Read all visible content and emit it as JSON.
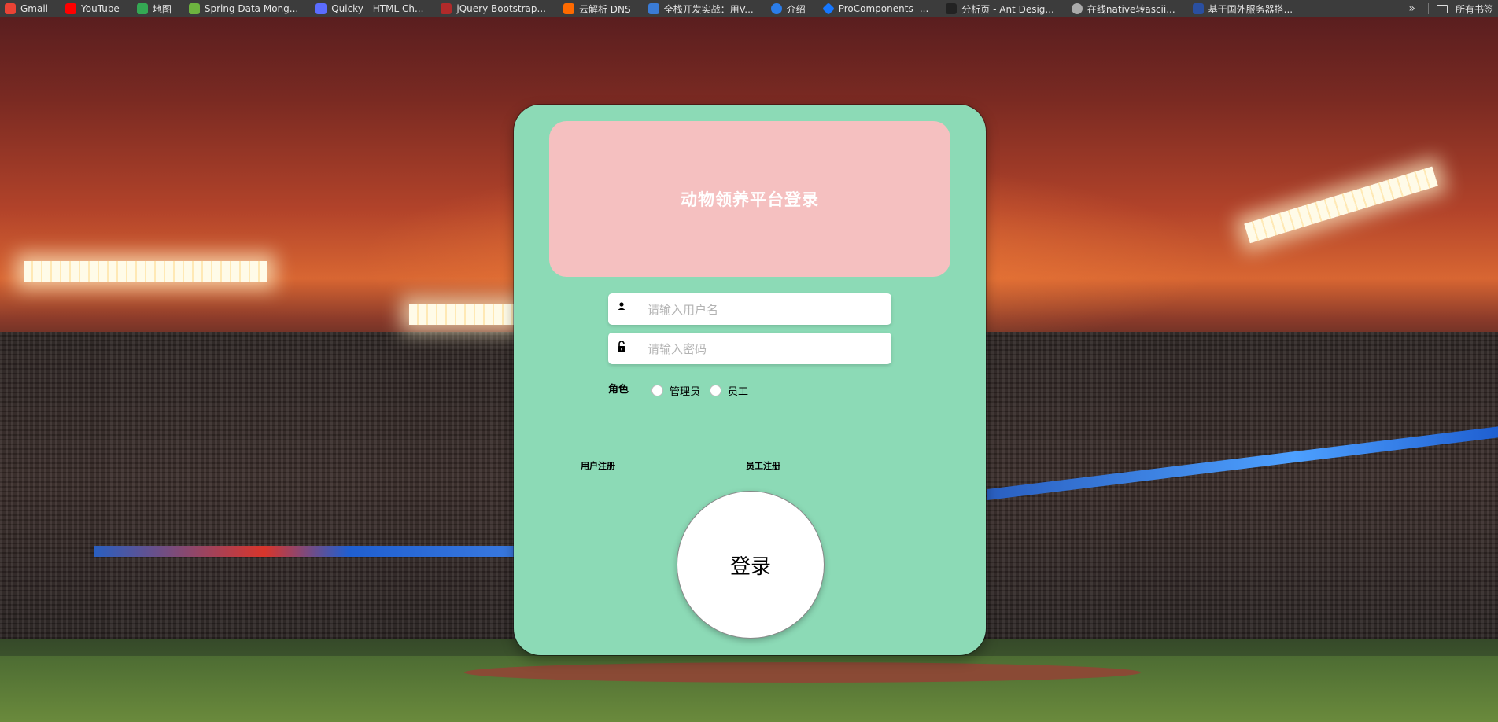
{
  "bookmarks": [
    {
      "label": "Gmail",
      "icon": "gmail-icon",
      "color": "#ea4335"
    },
    {
      "label": "YouTube",
      "icon": "youtube-icon",
      "color": "#ff0000"
    },
    {
      "label": "地图",
      "icon": "maps-icon",
      "color": "#34a853"
    },
    {
      "label": "Spring Data Mong...",
      "icon": "spring-icon",
      "color": "#6db33f"
    },
    {
      "label": "Quicky - HTML Ch...",
      "icon": "quicky-icon",
      "color": "#5b6cff"
    },
    {
      "label": "jQuery Bootstrap...",
      "icon": "jquery-icon",
      "color": "#b02a2a"
    },
    {
      "label": "云解析 DNS",
      "icon": "aliyun-icon",
      "color": "#ff6a00"
    },
    {
      "label": "全栈开发实战：用V...",
      "icon": "doc-icon",
      "color": "#3a7bd5"
    },
    {
      "label": "介绍",
      "icon": "intro-icon",
      "color": "#2b7de9"
    },
    {
      "label": "ProComponents -...",
      "icon": "procomponents-icon",
      "color": "#1677ff"
    },
    {
      "label": "分析页 - Ant Desig...",
      "icon": "antdesign-icon",
      "color": "#222222"
    },
    {
      "label": "在线native转ascii...",
      "icon": "globe-icon",
      "color": "#aaaaaa"
    },
    {
      "label": "基于国外服务器搭...",
      "icon": "flag-icon",
      "color": "#2a4fa0"
    }
  ],
  "bookmarks_more": "»",
  "all_bookmarks_label": "所有书签",
  "login": {
    "title": "动物领养平台登录",
    "username_placeholder": "请输入用户名",
    "password_placeholder": "请输入密码",
    "role_label": "角色",
    "roles": [
      "管理员",
      "员工"
    ],
    "user_register": "用户注册",
    "employee_register": "员工注册",
    "login_button": "登录"
  },
  "colors": {
    "card": "#8cdab6",
    "header": "#f5c0c0"
  }
}
